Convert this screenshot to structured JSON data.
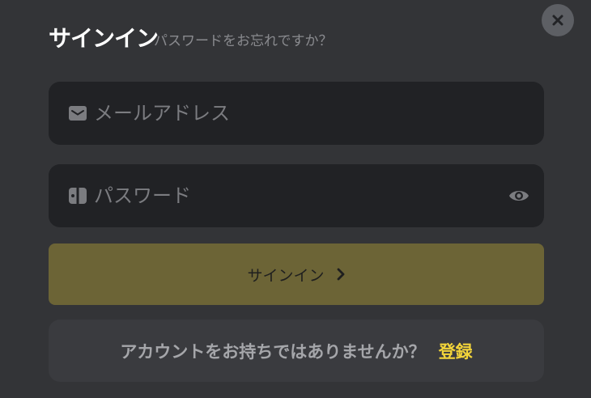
{
  "header": {
    "title": "サインイン",
    "forgot_password": "パスワードをお忘れですか？"
  },
  "close_icon": "close-icon",
  "email_field": {
    "placeholder": "メールアドレス",
    "icon": "mail-icon"
  },
  "password_field": {
    "placeholder": "パスワード",
    "icon": "key-icon",
    "toggle_icon": "eye-icon"
  },
  "signin_button": {
    "label": "サインイン",
    "icon": "chevron-right-icon",
    "color": "#6c6436"
  },
  "register": {
    "prompt": "アカウントをお持ちではありませんか？",
    "link": "登録",
    "link_color": "#f2d43a"
  },
  "background_color": "#333437"
}
